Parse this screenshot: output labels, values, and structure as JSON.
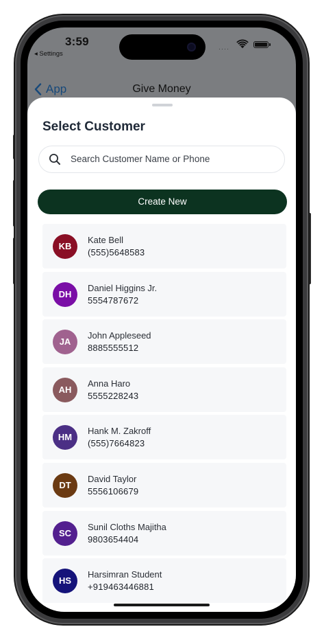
{
  "status_bar": {
    "time": "3:59",
    "back_app": "◂ Settings",
    "signal": "····"
  },
  "navbar": {
    "back_label": "App",
    "title": "Give Money"
  },
  "sheet": {
    "title": "Select Customer",
    "search_placeholder": "Search Customer Name or Phone",
    "search_value": "",
    "create_label": "Create New"
  },
  "customers": [
    {
      "initials": "KB",
      "name": "Kate Bell",
      "phone": "(555)5648583",
      "color": "#8a0f25"
    },
    {
      "initials": "DH",
      "name": "Daniel Higgins Jr.",
      "phone": "5554787672",
      "color": "#7a0ea6"
    },
    {
      "initials": "JA",
      "name": "John Appleseed",
      "phone": "8885555512",
      "color": "#a0628f"
    },
    {
      "initials": "AH",
      "name": "Anna Haro",
      "phone": "5555228243",
      "color": "#8a5a5e"
    },
    {
      "initials": "HM",
      "name": "Hank M. Zakroff",
      "phone": "(555)7664823",
      "color": "#4b2f85"
    },
    {
      "initials": "DT",
      "name": "David Taylor",
      "phone": "5556106679",
      "color": "#6b3a12"
    },
    {
      "initials": "SC",
      "name": "Sunil Cloths Majitha",
      "phone": "9803654404",
      "color": "#53208f"
    },
    {
      "initials": "HS",
      "name": "Harsimran Student",
      "phone": "+919463446881",
      "color": "#15137a"
    }
  ],
  "colors": {
    "accent_button": "#0c3320",
    "nav_blue": "#17497a",
    "row_bg": "#f6f7f9"
  },
  "icons": {
    "back": "chevron-left-icon",
    "search": "search-icon",
    "wifi": "wifi-icon",
    "battery": "battery-icon"
  }
}
